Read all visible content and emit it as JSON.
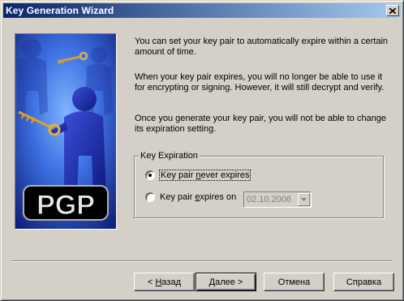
{
  "window": {
    "title": "Key Generation Wizard",
    "title_gradient": [
      "#0a246a",
      "#a6caf0"
    ]
  },
  "image": {
    "logo_text": "PGP"
  },
  "content": {
    "paragraph1": "You can set your key pair to automatically expire within a certain amount of time.",
    "paragraph2": "When your key pair expires, you will no longer be able to use it for encrypting or signing.  However, it will still decrypt and verify.",
    "paragraph3": "Once you generate your key pair, you will not be able to change its expiration setting."
  },
  "expiration_group": {
    "legend": "Key Expiration",
    "option_never": {
      "pre": "Key pair ",
      "accel": "n",
      "post": "ever expires",
      "selected": true
    },
    "option_expires": {
      "pre": "Key pair ",
      "accel": "e",
      "post": "xpires on",
      "selected": false
    },
    "date_value": "02.10.2006"
  },
  "buttons": {
    "back": {
      "pre": "< ",
      "accel": "Н",
      "post": "азад"
    },
    "next": {
      "pre": "",
      "accel": "Д",
      "post": "алее >"
    },
    "cancel": "Отмена",
    "help": "Справка"
  }
}
